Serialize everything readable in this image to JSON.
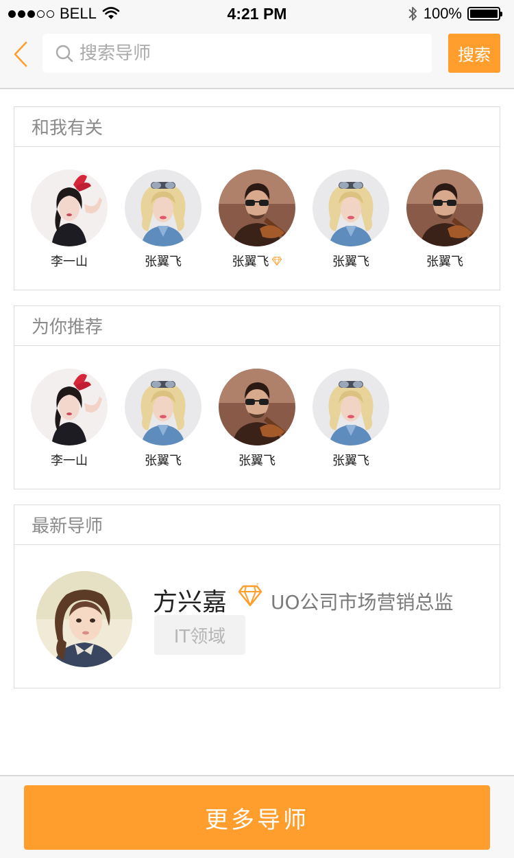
{
  "status_bar": {
    "carrier": "BELL",
    "time": "4:21 PM",
    "battery": "100%",
    "signal_dots_filled": 3,
    "signal_dots_total": 5
  },
  "nav": {
    "back_icon": "chevron-left-icon",
    "search_placeholder": "搜索导师",
    "search_button": "搜索"
  },
  "colors": {
    "accent": "#ff9e2c",
    "background": "#ffffff",
    "bar_background": "#f7f7f7",
    "border": "#dcdcdc",
    "header_text": "#8a8a8a"
  },
  "related": {
    "title": "和我有关",
    "people": [
      {
        "name": "李一山",
        "avatar": "woman-red-hair-bow",
        "vip": false
      },
      {
        "name": "张翼飞",
        "avatar": "blonde-woman-sunglasses",
        "vip": false
      },
      {
        "name": "张翼飞",
        "avatar": "man-sunglasses-violin",
        "vip": true
      },
      {
        "name": "张翼飞",
        "avatar": "blonde-woman-sunglasses",
        "vip": false
      },
      {
        "name": "张翼飞",
        "avatar": "man-sunglasses-violin",
        "vip": false
      }
    ]
  },
  "recommended": {
    "title": "为你推荐",
    "people": [
      {
        "name": "李一山",
        "avatar": "woman-red-hair-bow"
      },
      {
        "name": "张翼飞",
        "avatar": "blonde-woman-sunglasses"
      },
      {
        "name": "张翼飞",
        "avatar": "man-sunglasses-violin"
      },
      {
        "name": "张翼飞",
        "avatar": "blonde-woman-sunglasses"
      }
    ]
  },
  "latest": {
    "title": "最新导师",
    "mentor": {
      "name": "方兴嘉",
      "position": "UO公司市场营销总监",
      "tag": "IT领域",
      "avatar": "little-girl-bow-tie",
      "vip": true
    }
  },
  "footer": {
    "more_button": "更多导师"
  }
}
